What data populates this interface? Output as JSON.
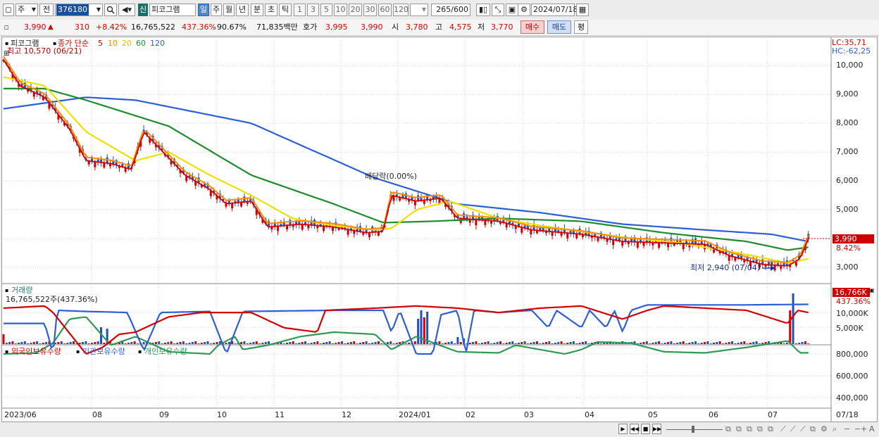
{
  "toolbar": {
    "type_selected": "주",
    "mode": "전",
    "code": "376180",
    "new_badge": "신",
    "stock_name": "피코그램",
    "periods": [
      "일",
      "주",
      "월",
      "년",
      "분",
      "초",
      "틱"
    ],
    "period_selected": "일",
    "intervals": [
      "1",
      "3",
      "5",
      "10",
      "20",
      "30",
      "60",
      "120"
    ],
    "count": "265",
    "count_total": "/600",
    "date": "2024/07/18"
  },
  "quote": {
    "price": "3,990",
    "change": "310",
    "change_pct": "+8.42%",
    "volume": "16,765,522",
    "volume_ratio": "437.36%",
    "rate": "90.67%",
    "amount": "71,835백만",
    "ask_label": "호가",
    "ask1": "3,995",
    "ask2": "3,990",
    "open_label": "시",
    "open": "3,780",
    "high_label": "고",
    "high": "4,575",
    "low_label": "저",
    "low": "3,770",
    "buy_label": "매수",
    "sell_label": "매도",
    "eval_label": "평"
  },
  "price_panel": {
    "name": "피코그램",
    "ma_label": "종가 단순",
    "ma": [
      {
        "period": "5",
        "color": "#d40000"
      },
      {
        "period": "10",
        "color": "#ff8c00"
      },
      {
        "period": "20",
        "color": "#e6d800"
      },
      {
        "period": "60",
        "color": "#1f8c2e"
      },
      {
        "period": "120",
        "color": "#2c5fd6"
      }
    ],
    "high_note": "최고 10,570 (06/21)",
    "low_note": "최저 2,940 (07/04)",
    "div_note": "배당락(0.00%)",
    "lc": "LC:35,71",
    "hc": "HC:-62,25",
    "yticks": [
      "10,000",
      "9,000",
      "8,000",
      "7,000",
      "6,000",
      "5,000",
      "4,000",
      "3,000"
    ],
    "last_price": "3,990",
    "last_pct": "8.42%"
  },
  "volume_panel": {
    "title": "거래량",
    "value": "16,765,522주(437.36%)",
    "yticks": [
      "10,000K",
      "5,000K"
    ],
    "last": "16,766K",
    "last_pct": "437.36%"
  },
  "holdings_panel": {
    "series": [
      {
        "name": "외국인보유수량",
        "color": "#d40000"
      },
      {
        "name": "기관보유수량",
        "color": "#2c5fd6"
      },
      {
        "name": "개인보유수량",
        "color": "#2f9a55"
      }
    ],
    "yticks": [
      "800,000",
      "600,000",
      "400,000"
    ]
  },
  "x_axis": [
    "2023/06",
    "08",
    "09",
    "10",
    "11",
    "12",
    "2024/01",
    "02",
    "03",
    "04",
    "05",
    "06",
    "07",
    "07/18"
  ]
}
